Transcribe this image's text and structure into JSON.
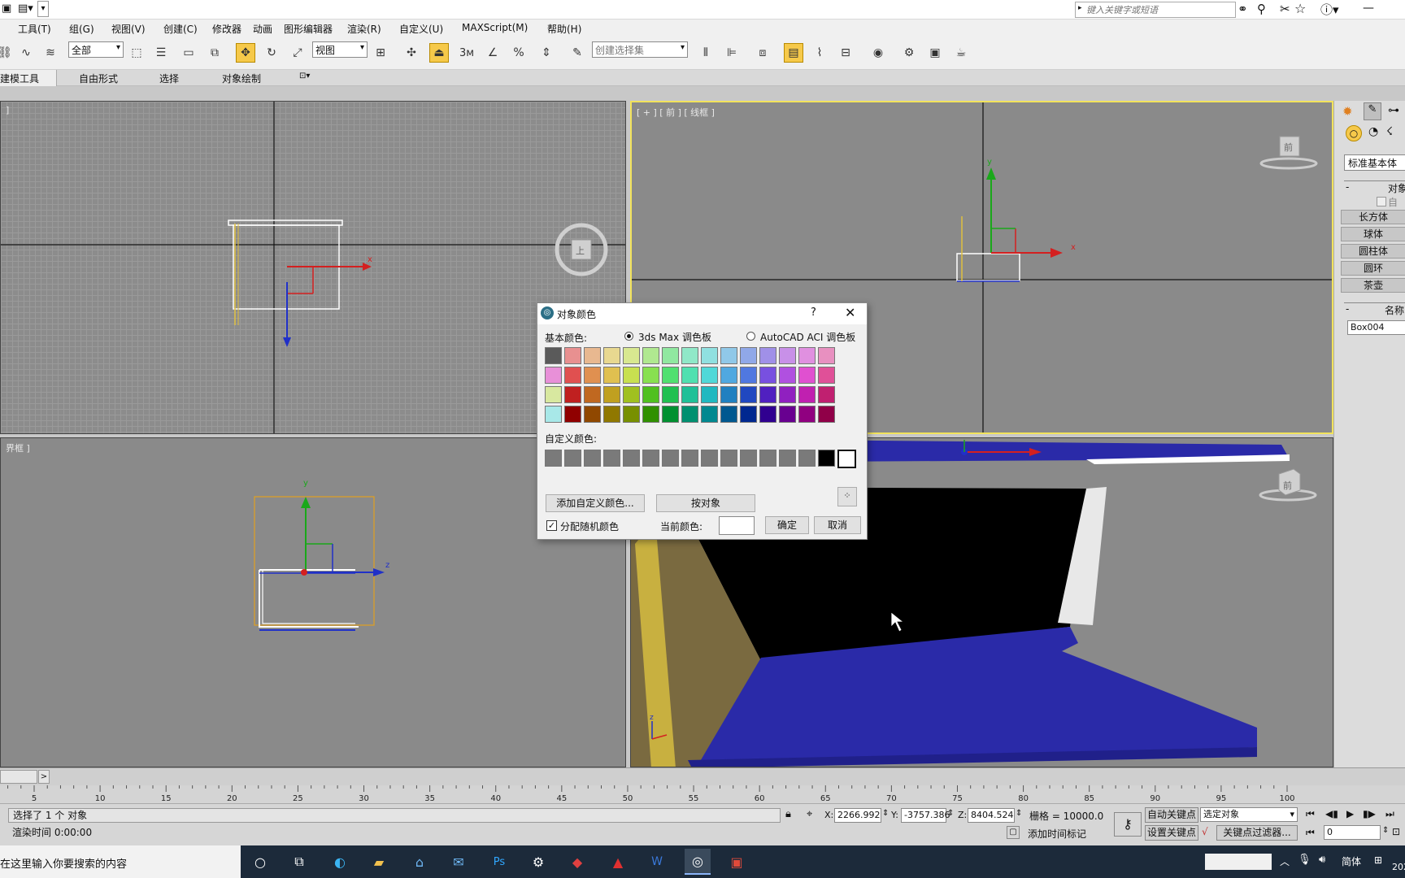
{
  "colors": {
    "accent": "#f6c94a",
    "viewport_active": "#f2e35c",
    "x_axis": "#d42020",
    "y_axis": "#1aa81a",
    "z_axis": "#2030c8",
    "box_blue": "#2a2aa8"
  },
  "titlebar": {
    "search_placeholder": "键入关键字或短语"
  },
  "menu": [
    "工具(T)",
    "组(G)",
    "视图(V)",
    "创建(C)",
    "修改器",
    "动画",
    "图形编辑器",
    "渲染(R)",
    "自定义(U)",
    "MAXScript(M)",
    "帮助(H)"
  ],
  "toolbar": {
    "filter_value": "全部",
    "coord_value": "视图",
    "selection_set_placeholder": "创建选择集",
    "snap_label": "3"
  },
  "ribbon": {
    "tabs": [
      "建模工具",
      "自由形式",
      "选择",
      "对象绘制"
    ]
  },
  "viewports": {
    "top_left_label": "]",
    "top_right_label": "[ + ] [ 前 ] [ 线框 ]",
    "bottom_left_label": "界框 ]",
    "viewcube_front": "前",
    "viewcube_top": "上",
    "axis_x": "x",
    "axis_y": "y",
    "axis_z": "z"
  },
  "command_panel": {
    "category_value": "标准基本体",
    "rollout_object_type": "对象",
    "autogrid_label": "自动",
    "buttons": [
      "长方体",
      "球体",
      "圆柱体",
      "圆环",
      "茶壶"
    ],
    "rollout_name": "名称",
    "name_value": "Box004"
  },
  "dialog": {
    "title": "对象颜色",
    "help": "?",
    "basic_colors_label": "基本颜色:",
    "palette_max": "3ds Max 调色板",
    "palette_aci": "AutoCAD ACI 调色板",
    "custom_colors_label": "自定义颜色:",
    "add_custom_button": "添加自定义颜色...",
    "by_object_button": "按对象",
    "random_checkbox_label": "分配随机颜色",
    "random_checked": true,
    "current_color_label": "当前颜色:",
    "current_color": "#ffffff",
    "ok_button": "确定",
    "cancel_button": "取消",
    "basic_swatches": [
      [
        "#5a5a5a",
        "#e89090",
        "#e8b890",
        "#e8d890",
        "#d8e890",
        "#b0e890",
        "#90e8a0",
        "#90e8c8",
        "#90e0e0",
        "#90c8e8",
        "#90a8e8",
        "#a090e8",
        "#c890e8",
        "#e090e0",
        "#e890c0"
      ],
      [
        "#e890d8",
        "#e05050",
        "#e09050",
        "#e0c050",
        "#c8e050",
        "#88e050",
        "#50e070",
        "#50e0b0",
        "#50d8d8",
        "#50a8e0",
        "#5078e0",
        "#7850e0",
        "#b050e0",
        "#e050d0",
        "#e05098"
      ],
      [
        "#d8e8a0",
        "#c02020",
        "#c06820",
        "#c0a020",
        "#a0c020",
        "#50c020",
        "#20c050",
        "#20c098",
        "#20b8c0",
        "#2080c0",
        "#2048c0",
        "#5020c0",
        "#9020c0",
        "#c020b0",
        "#c02070"
      ],
      [
        "#a8e8e8",
        "#900000",
        "#904800",
        "#907800",
        "#789000",
        "#309000",
        "#009030",
        "#009070",
        "#008890",
        "#005890",
        "#002890",
        "#300090",
        "#680090",
        "#900080",
        "#900048"
      ]
    ],
    "custom_swatches": [
      "#7a7a7a",
      "#7a7a7a",
      "#7a7a7a",
      "#7a7a7a",
      "#7a7a7a",
      "#7a7a7a",
      "#7a7a7a",
      "#7a7a7a",
      "#7a7a7a",
      "#7a7a7a",
      "#7a7a7a",
      "#7a7a7a",
      "#7a7a7a",
      "#7a7a7a",
      "#000000",
      "#ffffff"
    ]
  },
  "timeline": {
    "ticks": [
      "5",
      "10",
      "15",
      "20",
      "25",
      "30",
      "35",
      "40",
      "45",
      "50",
      "55",
      "60",
      "65",
      "70",
      "75",
      "80",
      "85",
      "90",
      "95",
      "100"
    ]
  },
  "status": {
    "selection_text": "选择了 1 个 对象",
    "render_time": "渲染时间 0:00:00",
    "x_label": "X:",
    "x_value": "2266.992",
    "y_label": "Y:",
    "y_value": "-3757.386",
    "z_label": "Z:",
    "z_value": "8404.524",
    "grid": "栅格 = 10000.0",
    "add_time_tag": "添加时间标记",
    "auto_key": "自动关键点",
    "set_key": "设置关键点",
    "selected_object": "选定对象",
    "key_filters": "关键点过滤器...",
    "frame_value": "0"
  },
  "taskbar": {
    "search_text": "在这里输入你要搜索的内容",
    "ime": "简体",
    "clock_fragment": "202"
  }
}
